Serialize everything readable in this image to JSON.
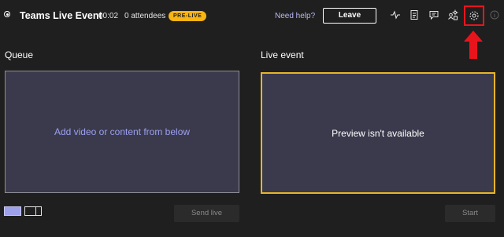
{
  "header": {
    "title": "Teams Live Event",
    "timer": "00:02",
    "attendees": "0 attendees",
    "status_badge": "PRE-LIVE",
    "help_link": "Need help?",
    "leave_label": "Leave",
    "toolbar_icons": [
      "health-icon",
      "notes-icon",
      "chat-icon",
      "people-icon",
      "settings-icon",
      "info-icon"
    ]
  },
  "queue": {
    "title": "Queue",
    "placeholder": "Add video or content from below",
    "send_label": "Send live"
  },
  "live_event": {
    "title": "Live event",
    "preview_text": "Preview isn't available",
    "start_label": "Start"
  },
  "colors": {
    "background": "#1f1f1f",
    "panel": "#3a3a4c",
    "badge": "#f8b413",
    "live_border": "#e7b526",
    "accent": "#9c9ff0",
    "highlight": "#e8141c"
  }
}
